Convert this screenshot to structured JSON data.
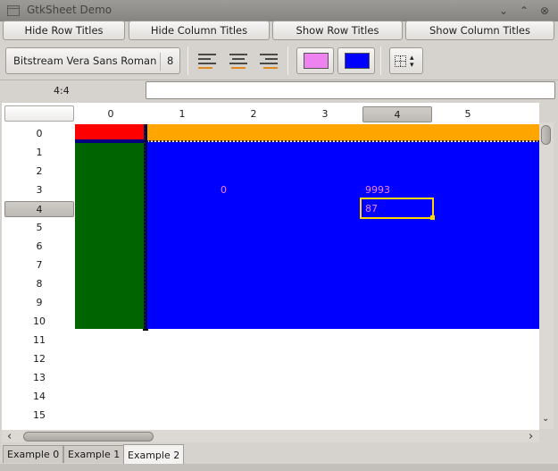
{
  "window": {
    "title": "GtkSheet Demo",
    "min_label": "⌄",
    "max_label": "⌃",
    "close_label": "⊗"
  },
  "toolbar": {
    "hide_row_titles": "Hide Row Titles",
    "hide_column_titles": "Hide Column Titles",
    "show_row_titles": "Show Row Titles",
    "show_column_titles": "Show Column Titles",
    "font_name": "Bitstream Vera Sans Roman",
    "font_size": "8",
    "fg_color": "#ee82ee",
    "bg_color": "#0000ff"
  },
  "entry": {
    "cell_name": "4:4",
    "value": ""
  },
  "sheet": {
    "column_titles": [
      "0",
      "1",
      "2",
      "3",
      "4",
      "5"
    ],
    "row_titles": [
      "0",
      "1",
      "2",
      "3",
      "4",
      "5",
      "6",
      "7",
      "8",
      "9",
      "10",
      "11",
      "12",
      "13",
      "14",
      "15"
    ],
    "selected_column": "4",
    "selected_row": "4",
    "cells": [
      {
        "row": 3,
        "col": 2,
        "text": "0",
        "color": "#ee82ee"
      },
      {
        "row": 3,
        "col": 4,
        "text": "9993",
        "color": "#ee82ee"
      },
      {
        "row": 4,
        "col": 4,
        "text": "87",
        "color": "#ee82ee"
      }
    ],
    "colors": {
      "red": "#ff0000",
      "orange": "#ffa500",
      "green": "#006400",
      "blue": "#0000ff",
      "active_border": "#ffd700"
    }
  },
  "scroll": {
    "h_left": "‹",
    "h_right": "›",
    "v_down": "⌄"
  },
  "tabs": [
    "Example 0",
    "Example 1",
    "Example 2"
  ],
  "active_tab": "Example 2"
}
